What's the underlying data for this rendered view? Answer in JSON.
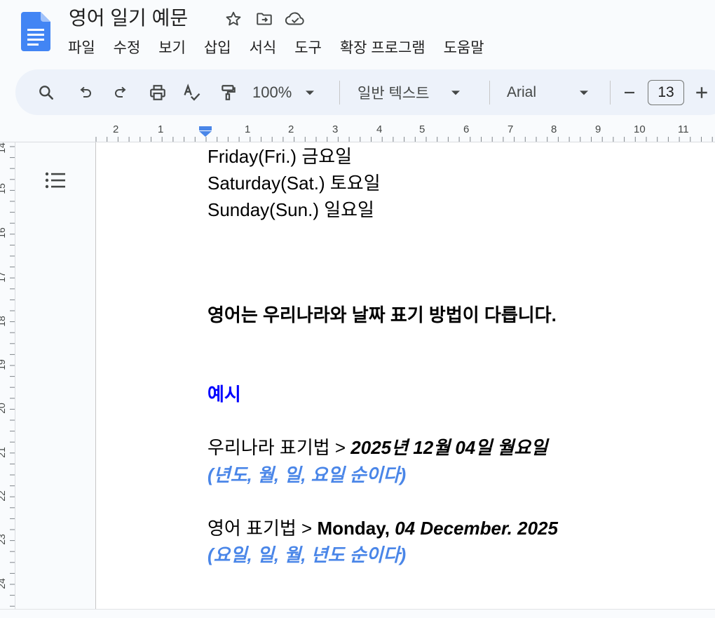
{
  "app": {
    "doc_title": "영어 일기 예문"
  },
  "menu": [
    "파일",
    "수정",
    "보기",
    "삽입",
    "서식",
    "도구",
    "확장 프로그램",
    "도움말"
  ],
  "toolbar": {
    "zoom": "100%",
    "paragraph_style": "일반 텍스트",
    "font": "Arial",
    "font_size": "13"
  },
  "ruler": {
    "h_ticks": [
      "2",
      "1",
      "1",
      "2",
      "3",
      "4",
      "5",
      "6",
      "7",
      "8",
      "9",
      "10",
      "11"
    ],
    "v_ticks": [
      "14",
      "15",
      "16",
      "17",
      "18",
      "19",
      "20",
      "21",
      "22",
      "23",
      "24"
    ]
  },
  "document": {
    "line_friday": "Friday(Fri.) 금요일",
    "line_saturday": "Saturday(Sat.) 토요일",
    "line_sunday": "Sunday(Sun.) 일요일",
    "heading_difference": "영어는 우리나라와 날짜 표기 방법이 다릅니다.",
    "example_label": "예시",
    "korean_prefix": "우리나라 표기법 > ",
    "korean_date": "2025년 12월 04일 월요일",
    "korean_order": "(년도, 월, 일, 요일 순이다)",
    "english_prefix": "영어 표기법 > ",
    "english_day": "Monday, ",
    "english_date": "04 December. 2025",
    "english_order": "(요일, 일, 월, 년도 순이다)"
  },
  "colors": {
    "example_heading": "#0000ff",
    "order_note": "#4a86e8",
    "toolbar_bg": "#edf2fa",
    "docs_blue": "#4285f4"
  },
  "icons": [
    "docs-logo",
    "star-icon",
    "move-to-folder-icon",
    "cloud-saved-icon",
    "search-icon",
    "undo-icon",
    "redo-icon",
    "print-icon",
    "spellcheck-icon",
    "paint-format-icon",
    "chevron-down-icon",
    "minus-icon",
    "plus-icon",
    "outline-icon"
  ]
}
